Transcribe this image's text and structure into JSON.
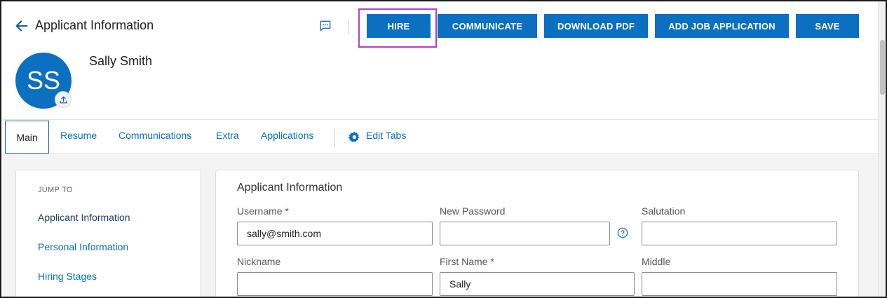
{
  "header": {
    "title": "Applicant Information",
    "icons": {
      "back": "arrow-left-icon",
      "chat": "chat-bubble-icon"
    },
    "buttons": {
      "hire": "HIRE",
      "communicate": "COMMUNICATE",
      "download_pdf": "DOWNLOAD PDF",
      "add_job_application": "ADD JOB APPLICATION",
      "save": "SAVE"
    }
  },
  "applicant": {
    "initials": "SS",
    "name": "Sally Smith",
    "upload_icon": "upload-icon"
  },
  "tabs": {
    "items": [
      {
        "label": "Main",
        "active": true
      },
      {
        "label": "Resume"
      },
      {
        "label": "Communications"
      },
      {
        "label": "Extra"
      },
      {
        "label": "Applications"
      }
    ],
    "edit_tabs": "Edit Tabs",
    "edit_icon": "gear-icon"
  },
  "jump_to": {
    "label": "JUMP TO",
    "items": [
      {
        "label": "Applicant Information",
        "active": true
      },
      {
        "label": "Personal Information"
      },
      {
        "label": "Hiring Stages"
      }
    ]
  },
  "form": {
    "section_title": "Applicant Information",
    "required_marker": "*",
    "fields": {
      "username": {
        "label": "Username",
        "value": "sally@smith.com",
        "required": true
      },
      "new_password": {
        "label": "New Password",
        "value": ""
      },
      "salutation": {
        "label": "Salutation",
        "value": ""
      },
      "nickname": {
        "label": "Nickname",
        "value": ""
      },
      "first_name": {
        "label": "First Name",
        "value": "Sally",
        "required": true
      },
      "middle": {
        "label": "Middle",
        "value": ""
      }
    },
    "help_icon": "question-circle-icon"
  },
  "colors": {
    "primary": "#0b6fc2",
    "highlight": "#b43fbd",
    "required": "#c6262e"
  }
}
